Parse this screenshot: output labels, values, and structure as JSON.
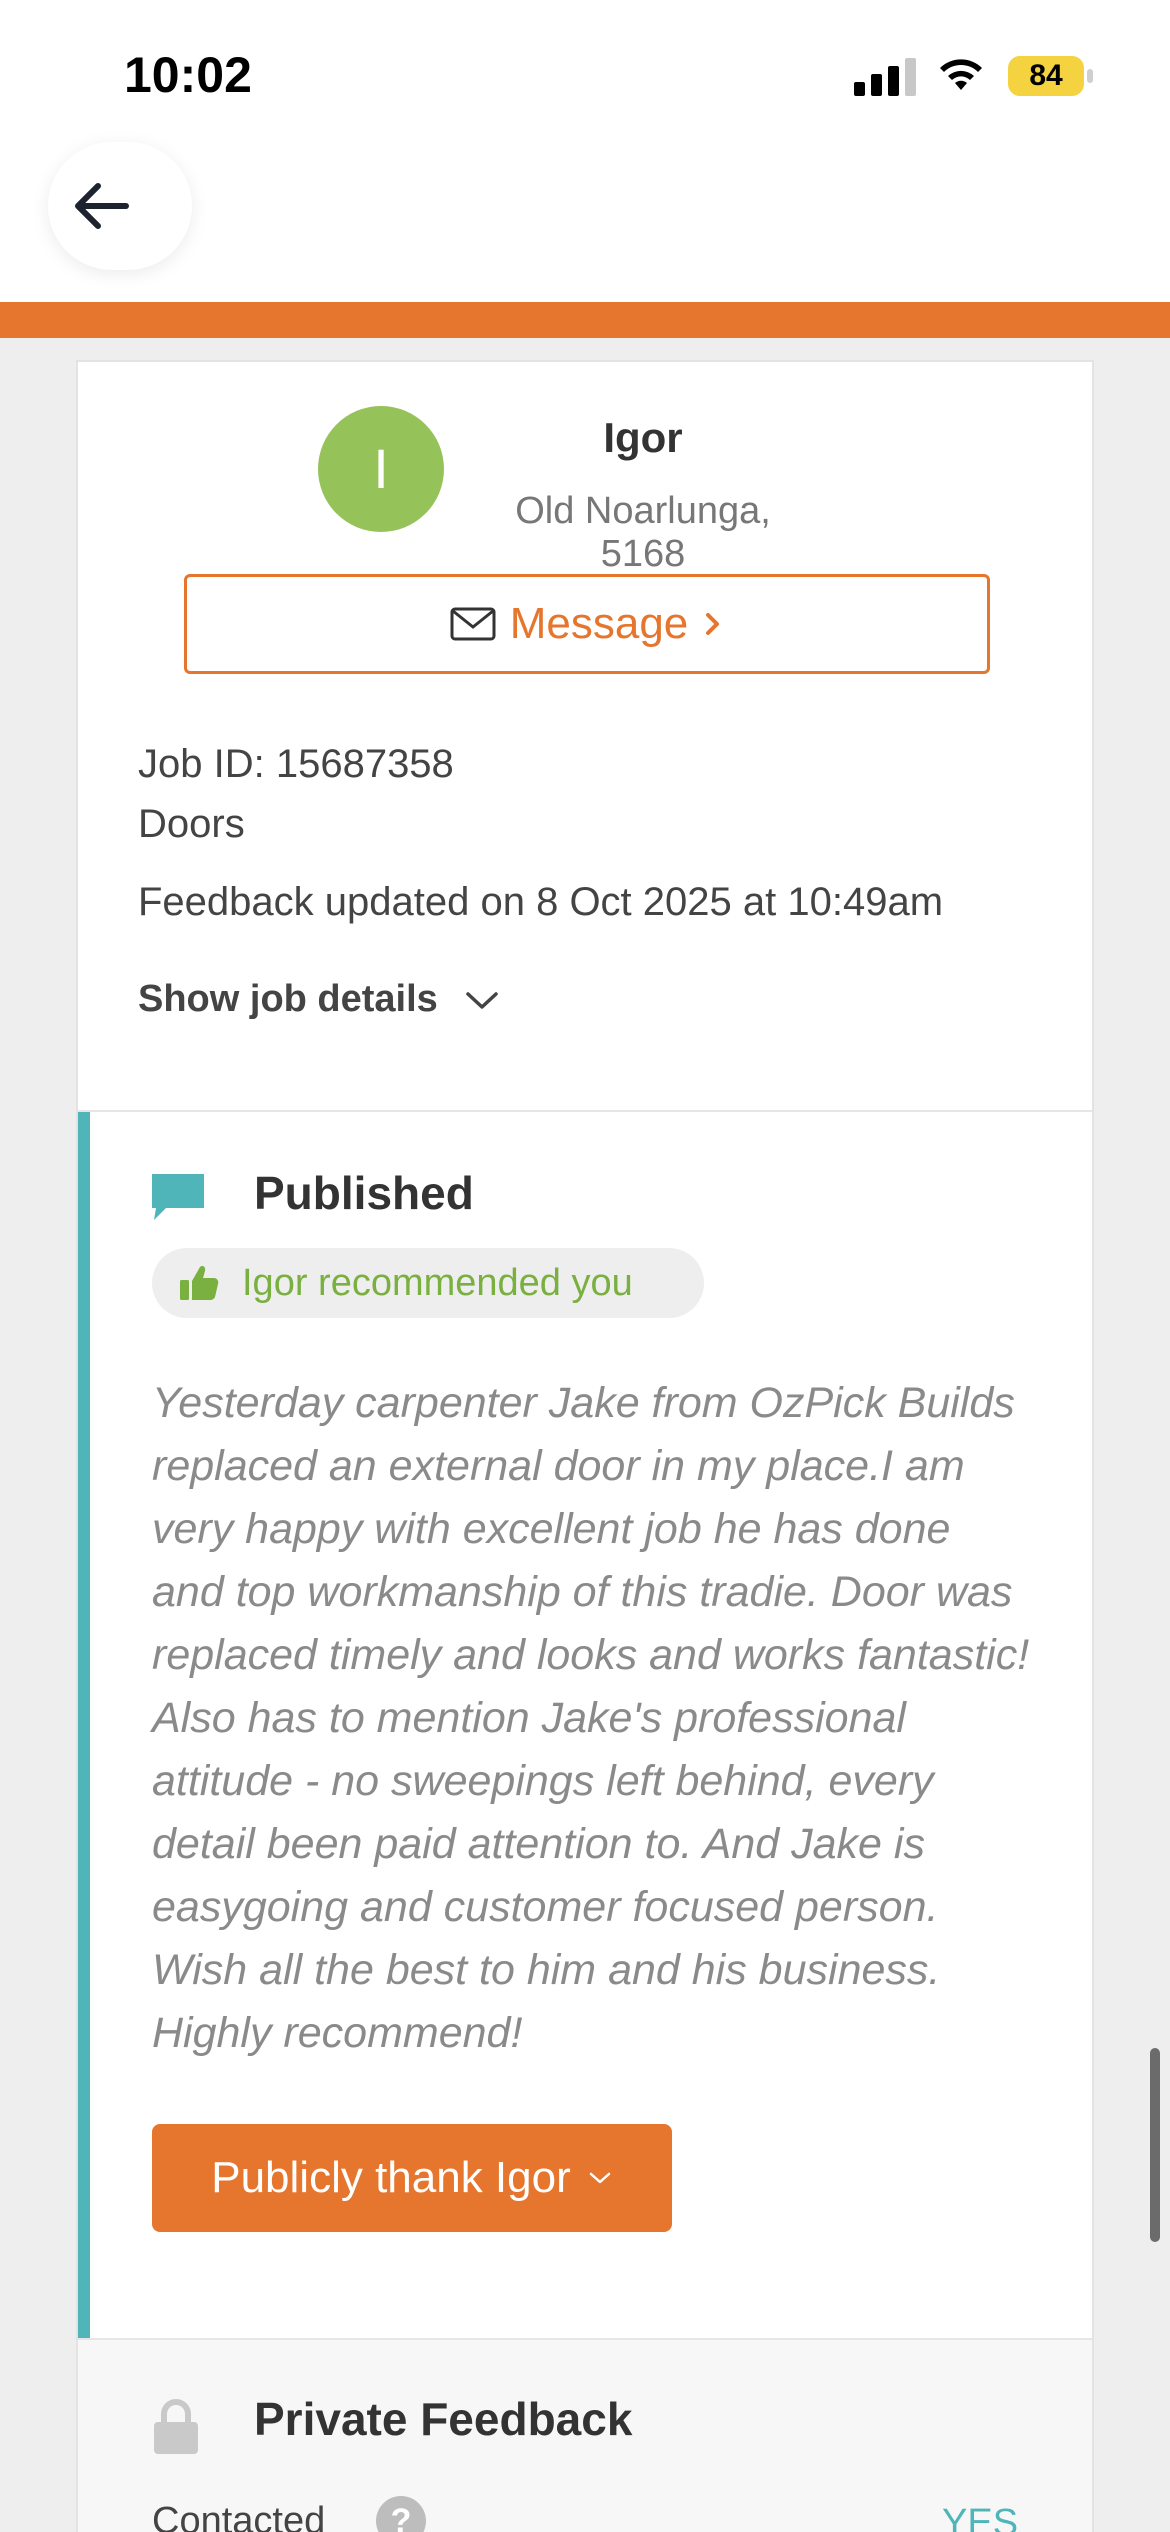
{
  "status_bar": {
    "time": "10:02",
    "battery": "84"
  },
  "header": {
    "back_icon": "arrow-left-icon"
  },
  "customer": {
    "avatar_letter": "I",
    "name": "Igor",
    "location": "Old Noarlunga, 5168",
    "message_label": "Message",
    "message_icon": "envelope-icon"
  },
  "job": {
    "job_id": "Job ID: 15687358",
    "category": "Doors",
    "feedback_updated": "Feedback updated on 8 Oct 2025 at 10:49am",
    "show_details_label": "Show job details"
  },
  "published": {
    "title": "Published",
    "recommendation": "Igor recommended you",
    "review": "Yesterday carpenter Jake from OzPick Builds replaced an external door in my place.I am very happy with excellent job he has done and top workmanship of this tradie. Door was replaced timely and looks and works fantastic! Also has to mention Jake's professional attitude - no sweepings left behind, every detail been paid attention to. And Jake is easygoing and customer focused person. Wish all the best to him and his business. Highly recommend!",
    "thank_button": "Publicly thank Igor"
  },
  "private_feedback": {
    "title": "Private Feedback",
    "contacted_label": "Contacted",
    "contacted_value": "YES"
  },
  "colors": {
    "accent": "#e6762e",
    "teal": "#4fb5b8",
    "avatar": "#96c25a",
    "green": "#7ab040"
  }
}
